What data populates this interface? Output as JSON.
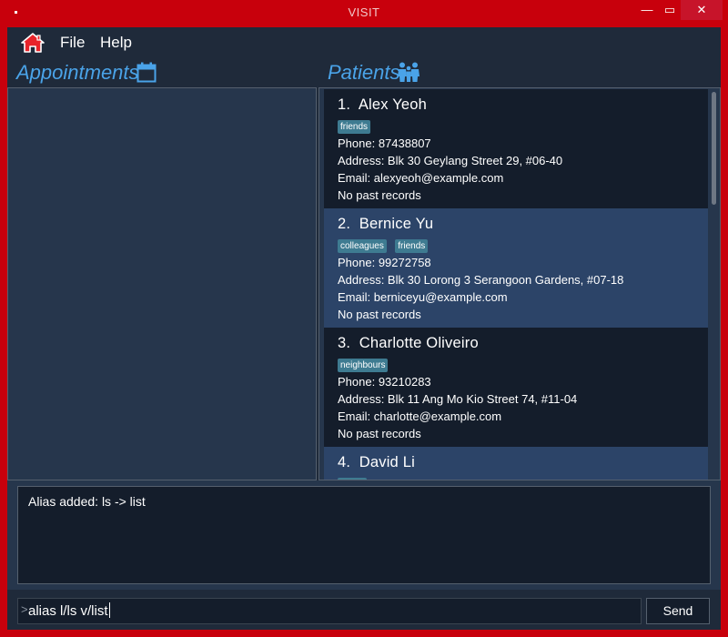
{
  "window": {
    "title": "VISIT",
    "minimize_glyph": "—",
    "maximize_glyph": "▭",
    "close_glyph": "✕"
  },
  "menu": {
    "home_icon": "home-icon",
    "file_label": "File",
    "help_label": "Help"
  },
  "appointments": {
    "title": "Appointments",
    "icon": "calendar-icon"
  },
  "patients": {
    "title": "Patients",
    "icon": "people-icon",
    "list": [
      {
        "index": "1.",
        "name": "Alex Yeoh",
        "tags": [
          "friends"
        ],
        "phone": "Phone: 87438807",
        "address": "Address: Blk 30 Geylang Street 29, #06-40",
        "email": "Email: alexyeoh@example.com",
        "records": "No past records"
      },
      {
        "index": "2.",
        "name": "Bernice Yu",
        "tags": [
          "colleagues",
          "friends"
        ],
        "phone": "Phone: 99272758",
        "address": "Address: Blk 30 Lorong 3 Serangoon Gardens, #07-18",
        "email": "Email: berniceyu@example.com",
        "records": "No past records"
      },
      {
        "index": "3.",
        "name": "Charlotte Oliveiro",
        "tags": [
          "neighbours"
        ],
        "phone": "Phone: 93210283",
        "address": "Address: Blk 11 Ang Mo Kio Street 74, #11-04",
        "email": "Email: charlotte@example.com",
        "records": "No past records"
      },
      {
        "index": "4.",
        "name": "David Li",
        "tags": [
          "family"
        ],
        "phone": "",
        "address": "",
        "email": "",
        "records": ""
      }
    ]
  },
  "result": {
    "text": "Alias added: ls -> list"
  },
  "command": {
    "prompt": ">",
    "value": "alias l/ls v/list",
    "send_label": "Send"
  },
  "colors": {
    "window_frame": "#c8000c",
    "background": "#1f2a3a",
    "card_dark": "#141d2b",
    "card_light": "#2c4468",
    "accent": "#4aa3e8",
    "tag": "#3e7b91",
    "home_icon": "#e8232a"
  }
}
